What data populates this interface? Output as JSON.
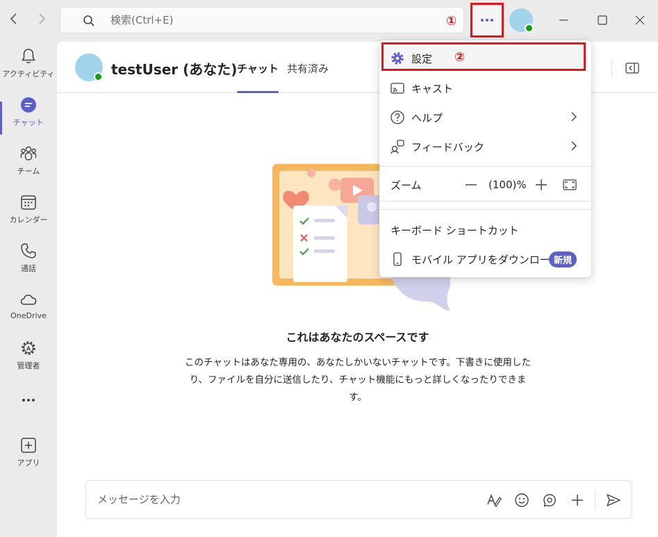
{
  "titlebar": {
    "back_icon": "chevron-left-icon",
    "forward_icon": "chevron-right-icon",
    "search_placeholder": "検索(Ctrl+E)",
    "more_icon": "more-dots-icon",
    "annotation_1": "①",
    "annotation_2": "②"
  },
  "rail": {
    "items": [
      {
        "label": "アクティビティ",
        "icon": "bell-icon"
      },
      {
        "label": "チャット",
        "icon": "chat-icon"
      },
      {
        "label": "チーム",
        "icon": "teams-icon"
      },
      {
        "label": "カレンダー",
        "icon": "calendar-icon"
      },
      {
        "label": "通話",
        "icon": "phone-icon"
      },
      {
        "label": "OneDrive",
        "icon": "cloud-icon"
      },
      {
        "label": "管理者",
        "icon": "admin-gear-icon"
      },
      {
        "label": "",
        "icon": "more-apps-icon"
      },
      {
        "label": "アプリ",
        "icon": "add-app-icon"
      }
    ]
  },
  "header": {
    "user_name": "testUser (あなた)",
    "tabs": [
      {
        "label": "チャット",
        "active": true
      },
      {
        "label": "共有済み",
        "active": false
      }
    ]
  },
  "empty_state": {
    "title": "これはあなたのスペースです",
    "description": "このチャットはあなた専用の、あなたしかいないチャットです。下書きに使用したり、ファイルを自分に送信したり、チャット機能にもっと詳しくなったりできます。"
  },
  "composer": {
    "placeholder": "メッセージを入力"
  },
  "menu": {
    "settings": "設定",
    "cast": "キャスト",
    "help": "ヘルプ",
    "feedback": "フィードバック",
    "zoom_label": "ズーム",
    "zoom_value": "(100)%",
    "shortcuts": "キーボード ショートカット",
    "mobile": "モバイル アプリをダウンロード",
    "new_badge": "新規"
  },
  "colors": {
    "accent": "#5b5fc7",
    "highlight": "#e8141b",
    "presence": "#13a10e"
  }
}
